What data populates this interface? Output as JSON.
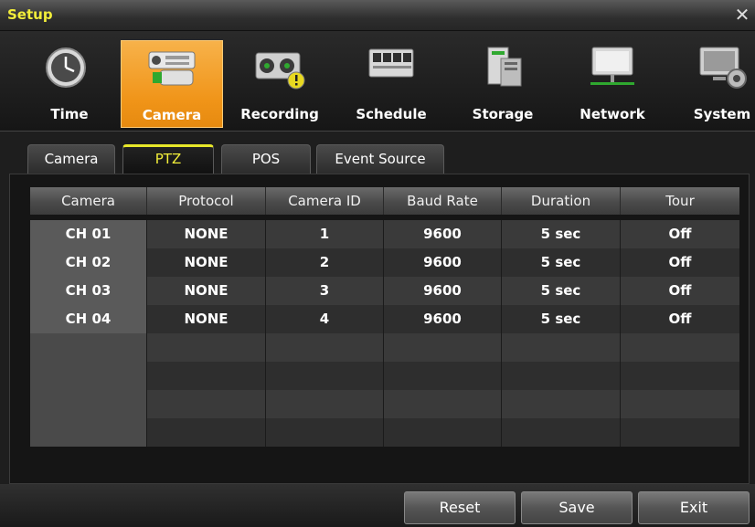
{
  "window": {
    "title": "Setup",
    "close_glyph": "✕"
  },
  "toolbar": {
    "items": [
      {
        "label": "Time",
        "icon": "clock-icon",
        "active": false
      },
      {
        "label": "Camera",
        "icon": "camera-icon",
        "active": true
      },
      {
        "label": "Recording",
        "icon": "recording-icon",
        "active": false
      },
      {
        "label": "Schedule",
        "icon": "schedule-icon",
        "active": false
      },
      {
        "label": "Storage",
        "icon": "storage-icon",
        "active": false
      },
      {
        "label": "Network",
        "icon": "network-icon",
        "active": false
      },
      {
        "label": "System",
        "icon": "system-icon",
        "active": false
      }
    ],
    "active_color": "#f09418"
  },
  "tabs": [
    {
      "label": "Camera",
      "active": false
    },
    {
      "label": "PTZ",
      "active": true
    },
    {
      "label": "POS",
      "active": false
    },
    {
      "label": "Event Source",
      "active": false
    }
  ],
  "table": {
    "headers": [
      "Camera",
      "Protocol",
      "Camera ID",
      "Baud Rate",
      "Duration",
      "Tour"
    ],
    "rows": [
      [
        "CH 01",
        "NONE",
        "1",
        "9600",
        "5 sec",
        "Off"
      ],
      [
        "CH 02",
        "NONE",
        "2",
        "9600",
        "5 sec",
        "Off"
      ],
      [
        "CH 03",
        "NONE",
        "3",
        "9600",
        "5 sec",
        "Off"
      ],
      [
        "CH 04",
        "NONE",
        "4",
        "9600",
        "5 sec",
        "Off"
      ]
    ],
    "empty_rows": 4
  },
  "buttons": {
    "reset": "Reset",
    "save": "Save",
    "exit": "Exit"
  },
  "colors": {
    "title_text": "#f2ee3a",
    "active_tab_accent": "#e8e82a"
  }
}
